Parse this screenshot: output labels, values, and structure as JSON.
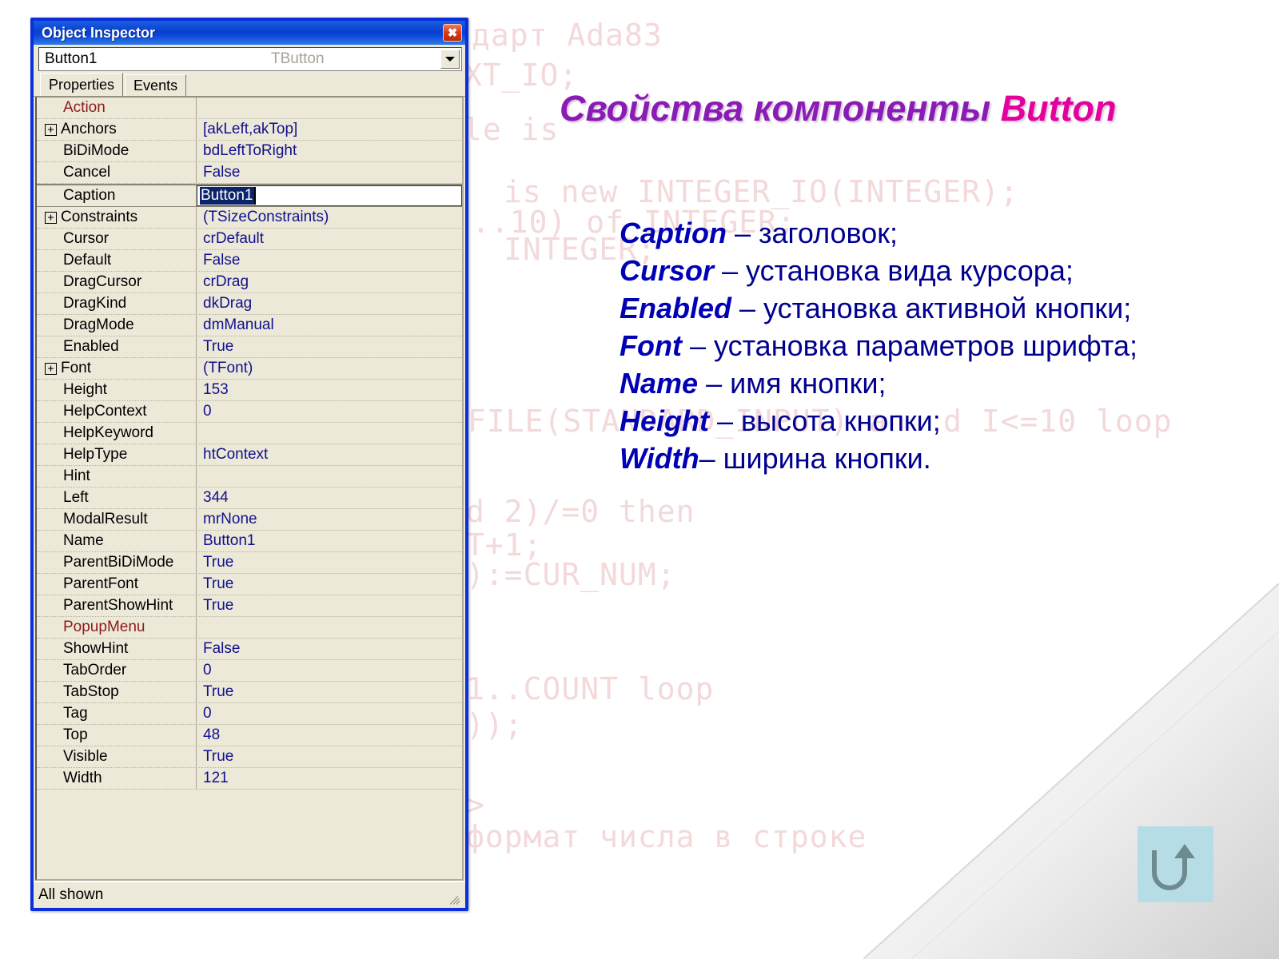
{
  "slide": {
    "heading_part1": "Свойства компоненты ",
    "heading_part2": "Button",
    "bullets": [
      {
        "term": "Caption",
        "desc": " – заголовок;"
      },
      {
        "term": "Cursor",
        "desc": " – установка вида курсора;"
      },
      {
        "term": "Enabled",
        "desc": " – установка активной кнопки;"
      },
      {
        "term": "Font",
        "desc": " – установка параметров шрифта;"
      },
      {
        "term": "Name",
        "desc": " – имя кнопки;"
      },
      {
        "term": "Height",
        "desc": " – высота кнопки;"
      },
      {
        "term": "Width",
        "desc": "– ширина кнопки."
      }
    ],
    "background_code": [
      "дарт Ada83",
      "XT_IO;",
      "le is",
      "is new INTEGER_IO(INTEGER);",
      "..10) of INTEGER;",
      "INTEGER;",
      "FILE(STANDARD_INPUT) an",
      "d I<=10 loop",
      "d 2)/=0 then",
      "T+1;",
      "):=CUR_NUM;",
      "1..COUNT loop",
      "));",
      ">",
      "формат числа в строке"
    ],
    "return_button": {
      "icon": "u-turn-arrow-icon",
      "bg_color": "#b6dde5",
      "arrow_color": "#6d8a8f"
    },
    "colors": {
      "heading_purple": "#8b1bb5",
      "heading_magenta": "#e4009e",
      "bullet_navy": "#00008f",
      "window_border_blue": "#0a2fdb",
      "property_value_blue": "#10108e",
      "property_event_red": "#8e1a1a"
    }
  },
  "inspector": {
    "title": "Object Inspector",
    "close_label": "✖",
    "combo": {
      "object_name": "Button1",
      "object_class": "TButton",
      "dropdown_icon": "chevron-down-icon"
    },
    "tabs": [
      {
        "label": "Properties",
        "active": true
      },
      {
        "label": "Events",
        "active": false
      }
    ],
    "status": "All shown",
    "rows": [
      {
        "name": "Action",
        "value": "",
        "expandable": false,
        "name_color": "red",
        "selected": false
      },
      {
        "name": "Anchors",
        "value": "[akLeft,akTop]",
        "expandable": true,
        "name_color": "black",
        "selected": false
      },
      {
        "name": "BiDiMode",
        "value": "bdLeftToRight",
        "expandable": false,
        "name_color": "black",
        "selected": false
      },
      {
        "name": "Cancel",
        "value": "False",
        "expandable": false,
        "name_color": "black",
        "selected": false
      },
      {
        "name": "Caption",
        "value": "Button1",
        "expandable": false,
        "name_color": "black",
        "selected": true
      },
      {
        "name": "Constraints",
        "value": "(TSizeConstraints)",
        "expandable": true,
        "name_color": "black",
        "selected": false
      },
      {
        "name": "Cursor",
        "value": "crDefault",
        "expandable": false,
        "name_color": "black",
        "selected": false
      },
      {
        "name": "Default",
        "value": "False",
        "expandable": false,
        "name_color": "black",
        "selected": false
      },
      {
        "name": "DragCursor",
        "value": "crDrag",
        "expandable": false,
        "name_color": "black",
        "selected": false
      },
      {
        "name": "DragKind",
        "value": "dkDrag",
        "expandable": false,
        "name_color": "black",
        "selected": false
      },
      {
        "name": "DragMode",
        "value": "dmManual",
        "expandable": false,
        "name_color": "black",
        "selected": false
      },
      {
        "name": "Enabled",
        "value": "True",
        "expandable": false,
        "name_color": "black",
        "selected": false
      },
      {
        "name": "Font",
        "value": "(TFont)",
        "expandable": true,
        "name_color": "black",
        "selected": false
      },
      {
        "name": "Height",
        "value": "153",
        "expandable": false,
        "name_color": "black",
        "selected": false
      },
      {
        "name": "HelpContext",
        "value": "0",
        "expandable": false,
        "name_color": "black",
        "selected": false
      },
      {
        "name": "HelpKeyword",
        "value": "",
        "expandable": false,
        "name_color": "black",
        "selected": false
      },
      {
        "name": "HelpType",
        "value": "htContext",
        "expandable": false,
        "name_color": "black",
        "selected": false
      },
      {
        "name": "Hint",
        "value": "",
        "expandable": false,
        "name_color": "black",
        "selected": false
      },
      {
        "name": "Left",
        "value": "344",
        "expandable": false,
        "name_color": "black",
        "selected": false
      },
      {
        "name": "ModalResult",
        "value": "mrNone",
        "expandable": false,
        "name_color": "black",
        "selected": false
      },
      {
        "name": "Name",
        "value": "Button1",
        "expandable": false,
        "name_color": "black",
        "selected": false
      },
      {
        "name": "ParentBiDiMode",
        "value": "True",
        "expandable": false,
        "name_color": "black",
        "selected": false
      },
      {
        "name": "ParentFont",
        "value": "True",
        "expandable": false,
        "name_color": "black",
        "selected": false
      },
      {
        "name": "ParentShowHint",
        "value": "True",
        "expandable": false,
        "name_color": "black",
        "selected": false
      },
      {
        "name": "PopupMenu",
        "value": "",
        "expandable": false,
        "name_color": "red",
        "selected": false
      },
      {
        "name": "ShowHint",
        "value": "False",
        "expandable": false,
        "name_color": "black",
        "selected": false
      },
      {
        "name": "TabOrder",
        "value": "0",
        "expandable": false,
        "name_color": "black",
        "selected": false
      },
      {
        "name": "TabStop",
        "value": "True",
        "expandable": false,
        "name_color": "black",
        "selected": false
      },
      {
        "name": "Tag",
        "value": "0",
        "expandable": false,
        "name_color": "black",
        "selected": false
      },
      {
        "name": "Top",
        "value": "48",
        "expandable": false,
        "name_color": "black",
        "selected": false
      },
      {
        "name": "Visible",
        "value": "True",
        "expandable": false,
        "name_color": "black",
        "selected": false
      },
      {
        "name": "Width",
        "value": "121",
        "expandable": false,
        "name_color": "black",
        "selected": false
      }
    ]
  }
}
